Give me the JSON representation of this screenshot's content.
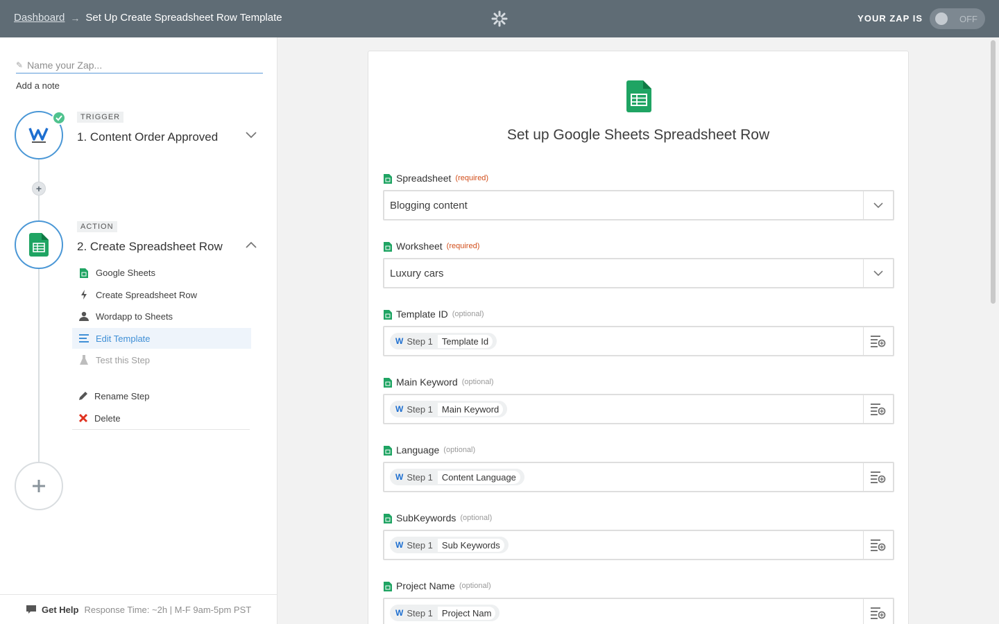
{
  "breadcrumb": {
    "home": "Dashboard",
    "arrow": "→",
    "current": "Set Up Create Spreadsheet Row Template"
  },
  "zap_status": {
    "label": "YOUR ZAP IS",
    "state": "OFF"
  },
  "sidebar": {
    "zap_name_placeholder": "Name your Zap...",
    "add_note": "Add a note",
    "trigger": {
      "tag": "TRIGGER",
      "title": "1. Content Order Approved"
    },
    "action": {
      "tag": "ACTION",
      "title": "2. Create Spreadsheet Row"
    },
    "action_items": [
      {
        "label": "Google Sheets",
        "icon": "sheets-icon"
      },
      {
        "label": "Create Spreadsheet Row",
        "icon": "bolt-icon"
      },
      {
        "label": "Wordapp to Sheets",
        "icon": "user-icon"
      },
      {
        "label": "Edit Template",
        "icon": "lines-icon"
      },
      {
        "label": "Test this Step",
        "icon": "flask-icon"
      },
      {
        "label": "Rename Step",
        "icon": "pencil-icon"
      },
      {
        "label": "Delete",
        "icon": "x-icon"
      }
    ],
    "help": {
      "title": "Get Help",
      "meta": "Response Time: ~2h | M-F 9am-5pm PST"
    }
  },
  "panel": {
    "title": "Set up Google Sheets Spreadsheet Row",
    "fields": [
      {
        "label": "Spreadsheet",
        "qualifier": "(required)",
        "value": "Blogging content"
      },
      {
        "label": "Worksheet",
        "qualifier": "(required)",
        "value": "Luxury cars"
      },
      {
        "label": "Template ID",
        "qualifier": "(optional)",
        "step": "Step 1",
        "field": "Template Id"
      },
      {
        "label": "Main Keyword",
        "qualifier": "(optional)",
        "step": "Step 1",
        "field": "Main Keyword"
      },
      {
        "label": "Language",
        "qualifier": "(optional)",
        "step": "Step 1",
        "field": "Content Language"
      },
      {
        "label": "SubKeywords",
        "qualifier": "(optional)",
        "step": "Step 1",
        "field": "Sub Keywords"
      },
      {
        "label": "Project Name",
        "qualifier": "(optional)",
        "step": "Step 1",
        "field": "Project Nam"
      }
    ]
  },
  "colors": {
    "topbar": "#5f6c75",
    "accent": "#4a97d6",
    "sheets": "#1fa463",
    "required": "#d24e1a",
    "success": "#4fc28e"
  }
}
